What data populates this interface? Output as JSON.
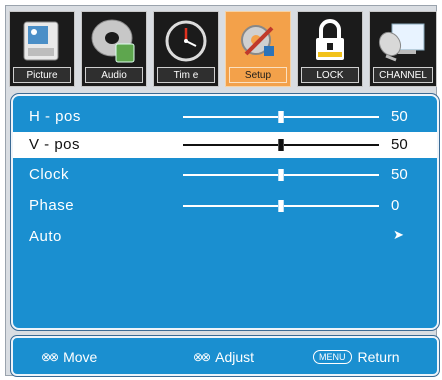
{
  "tabs": [
    {
      "label": "Picture",
      "icon": "tv-picture-icon"
    },
    {
      "label": "Audio",
      "icon": "disc-audio-icon"
    },
    {
      "label": "Tim e",
      "icon": "clock-icon"
    },
    {
      "label": "Setup",
      "icon": "gear-tools-icon",
      "active": true
    },
    {
      "label": "LOCK",
      "icon": "lock-icon"
    },
    {
      "label": "CHANNEL",
      "icon": "satellite-dish-icon"
    }
  ],
  "settings": [
    {
      "label": "H - pos",
      "value": "50",
      "level": 0.5
    },
    {
      "label": "V - pos",
      "value": "50",
      "level": 0.5,
      "selected": true
    },
    {
      "label": "Clock",
      "value": "50",
      "level": 0.5
    },
    {
      "label": "Phase",
      "value": "0",
      "level": 0.5
    },
    {
      "label": "Auto",
      "value": "➤"
    }
  ],
  "footer": {
    "move_icon": "⊗⊗",
    "move_label": "Move",
    "adjust_icon": "⊗⊗",
    "adjust_label": "Adjust",
    "menu_key": "MENU",
    "return_label": "Return"
  },
  "colors": {
    "panel": "#1a8fd0",
    "active_tab": "#f3a14a",
    "tab": "#1b1b1b"
  }
}
